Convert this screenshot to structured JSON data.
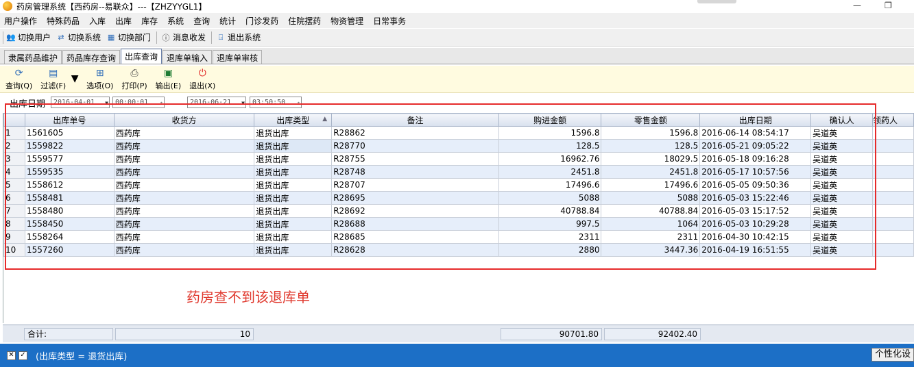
{
  "window": {
    "title": "药房管理系统【西药房--易联众】---【ZHZYYGL1】"
  },
  "menu": [
    "用户操作",
    "特殊药品",
    "入库",
    "出库",
    "库存",
    "系统",
    "查询",
    "统计",
    "门诊发药",
    "住院摆药",
    "物资管理",
    "日常事务"
  ],
  "toolbar": [
    "切换用户",
    "切换系统",
    "切换部门",
    "消息收发",
    "退出系统"
  ],
  "tabs": [
    "隶属药品维护",
    "药品库存查询",
    "出库查询",
    "退库单输入",
    "退库单审核"
  ],
  "actions": [
    "查询(Q)",
    "过滤(F)",
    "选项(O)",
    "打印(P)",
    "输出(E)",
    "退出(X)"
  ],
  "filter": {
    "label": "出库日期",
    "from_date": "2016-04-01",
    "from_time": "00:00:01",
    "to_date": "2016-06-21",
    "to_time": "03:50:50"
  },
  "table": {
    "columns": [
      "出库单号",
      "收货方",
      "出库类型",
      "备注",
      "购进金额",
      "零售金额",
      "出库日期",
      "确认人",
      "领药人"
    ],
    "rows": [
      [
        "1",
        "1561605",
        "西药库",
        "退货出库",
        "R28862",
        "1596.8",
        "1596.8",
        "2016-06-14 08:54:17",
        "吴道英"
      ],
      [
        "2",
        "1559822",
        "西药库",
        "退货出库",
        "R28770",
        "128.5",
        "128.5",
        "2016-05-21 09:05:22",
        "吴道英"
      ],
      [
        "3",
        "1559577",
        "西药库",
        "退货出库",
        "R28755",
        "16962.76",
        "18029.5",
        "2016-05-18 09:16:28",
        "吴道英"
      ],
      [
        "4",
        "1559535",
        "西药库",
        "退货出库",
        "R28748",
        "2451.8",
        "2451.8",
        "2016-05-17 10:57:56",
        "吴道英"
      ],
      [
        "5",
        "1558612",
        "西药库",
        "退货出库",
        "R28707",
        "17496.6",
        "17496.6",
        "2016-05-05 09:50:36",
        "吴道英"
      ],
      [
        "6",
        "1558481",
        "西药库",
        "退货出库",
        "R28695",
        "5088",
        "5088",
        "2016-05-03 15:22:46",
        "吴道英"
      ],
      [
        "7",
        "1558480",
        "西药库",
        "退货出库",
        "R28692",
        "40788.84",
        "40788.84",
        "2016-05-03 15:17:52",
        "吴道英"
      ],
      [
        "8",
        "1558450",
        "西药库",
        "退货出库",
        "R28688",
        "997.5",
        "1064",
        "2016-05-03 10:29:28",
        "吴道英"
      ],
      [
        "9",
        "1558264",
        "西药库",
        "退货出库",
        "R28685",
        "2311",
        "2311",
        "2016-04-30 10:42:15",
        "吴道英"
      ],
      [
        "10",
        "1557260",
        "西药库",
        "退货出库",
        "R28628",
        "2880",
        "3447.36",
        "2016-04-19 16:51:55",
        "吴道英"
      ]
    ]
  },
  "annotation": "药房查不到该退库单",
  "totals": {
    "label": "合计:",
    "count": "10",
    "purchase": "90701.80",
    "retail": "92402.40"
  },
  "status": {
    "filter_text": "(出库类型 = 退货出库)",
    "custom_button": "个性化设"
  }
}
